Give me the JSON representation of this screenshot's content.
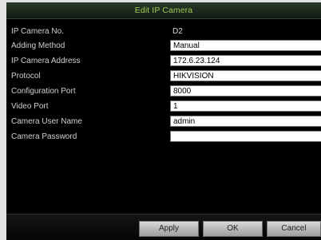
{
  "dialog": {
    "title": "Edit IP Camera"
  },
  "fields": {
    "camera_no": {
      "label": "IP Camera No.",
      "value": "D2"
    },
    "adding_method": {
      "label": "Adding Method",
      "value": "Manual"
    },
    "ip_address": {
      "label": "IP Camera Address",
      "value": "172.6.23.124"
    },
    "protocol": {
      "label": "Protocol",
      "value": "HIKVISION"
    },
    "config_port": {
      "label": "Configuration Port",
      "value": "8000"
    },
    "video_port": {
      "label": "Video Port",
      "value": "1"
    },
    "user_name": {
      "label": "Camera User Name",
      "value": "admin"
    },
    "password": {
      "label": "Camera Password",
      "value": ""
    }
  },
  "buttons": {
    "apply": "Apply",
    "ok": "OK",
    "cancel": "Cancel"
  },
  "colors": {
    "title_text": "#9fcb54",
    "dialog_background": "#000000",
    "page_background": "#e2e2e2"
  }
}
